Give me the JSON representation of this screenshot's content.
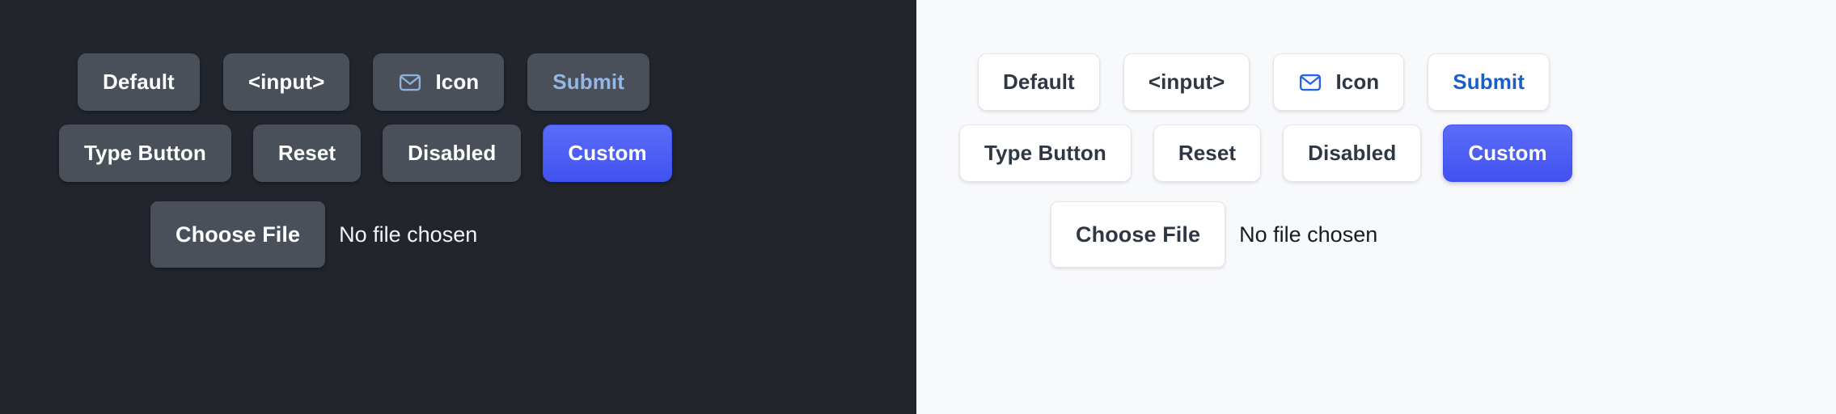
{
  "layout": {
    "panes": [
      "dark",
      "light"
    ],
    "rows": 3
  },
  "theme": {
    "dark": {
      "background": "#22262c",
      "button_bg": "#4a505a",
      "button_text": "#ffffff",
      "accent_text": "#93b7e8",
      "custom_bg": "#4f63f5",
      "icon_color": "#8fb1da",
      "file_status_text": "#f2f4f7"
    },
    "light": {
      "background": "#f8f9fb",
      "button_bg": "#ffffff",
      "button_border": "#e2e5ea",
      "button_text": "#2f3744",
      "accent_text": "#1a5fc8",
      "custom_bg": "#4f63f5",
      "icon_color": "#2563eb",
      "file_status_text": "#171c24"
    }
  },
  "buttons": {
    "row1": [
      {
        "label": "Default",
        "variant": "default"
      },
      {
        "label": "<input>",
        "variant": "default"
      },
      {
        "label": "Icon",
        "variant": "icon",
        "icon": "envelope-icon"
      },
      {
        "label": "Submit",
        "variant": "accent-text"
      }
    ],
    "row2": [
      {
        "label": "Type Button",
        "variant": "default"
      },
      {
        "label": "Reset",
        "variant": "default"
      },
      {
        "label": "Disabled",
        "variant": "disabled"
      },
      {
        "label": "Custom",
        "variant": "custom"
      }
    ],
    "row3": [
      {
        "label": "Choose File",
        "variant": "file",
        "status": "No file chosen"
      }
    ]
  }
}
